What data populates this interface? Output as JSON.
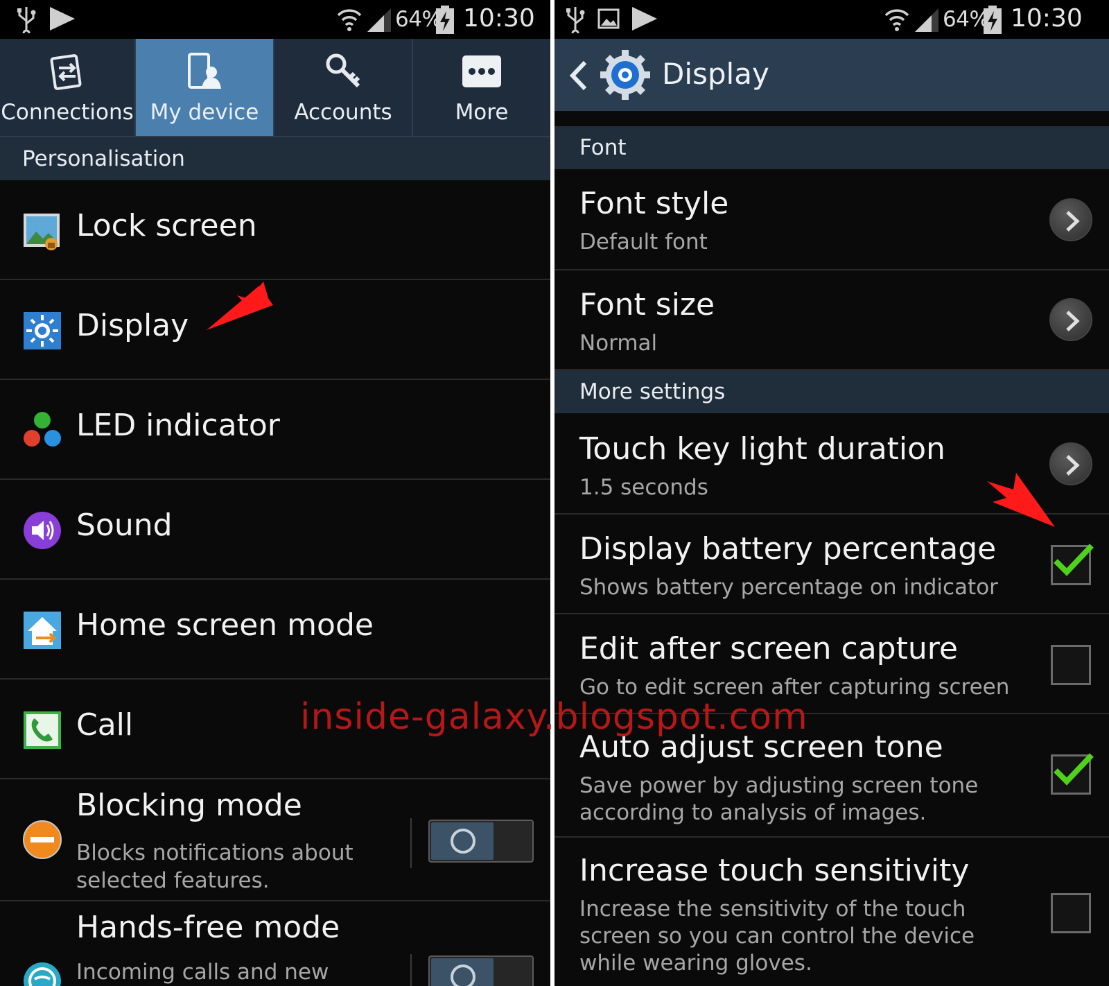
{
  "left": {
    "status": {
      "battery": "64%",
      "time": "10:30"
    },
    "tabs": [
      {
        "label": "Connections",
        "icon": "connections-icon"
      },
      {
        "label": "My device",
        "icon": "my-device-icon",
        "active": true
      },
      {
        "label": "Accounts",
        "icon": "accounts-icon"
      },
      {
        "label": "More",
        "icon": "more-icon"
      }
    ],
    "section": "Personalisation",
    "items": [
      {
        "title": "Lock screen",
        "icon": "lock-screen-icon"
      },
      {
        "title": "Display",
        "icon": "display-icon"
      },
      {
        "title": "LED indicator",
        "icon": "led-indicator-icon"
      },
      {
        "title": "Sound",
        "icon": "sound-icon"
      },
      {
        "title": "Home screen mode",
        "icon": "home-screen-icon"
      },
      {
        "title": "Call",
        "icon": "call-icon"
      },
      {
        "title": "Blocking mode",
        "sub": "Blocks notifications about selected features.",
        "icon": "blocking-mode-icon",
        "toggle": false
      },
      {
        "title": "Hands-free mode",
        "sub": "Incoming calls and new",
        "icon": "hands-free-icon",
        "toggle": false
      }
    ]
  },
  "right": {
    "status": {
      "battery": "64%",
      "time": "10:30"
    },
    "title": "Display",
    "sections": {
      "font": "Font",
      "more": "More settings"
    },
    "items": [
      {
        "title": "Font style",
        "sub": "Default font"
      },
      {
        "title": "Font size",
        "sub": "Normal"
      },
      {
        "title": "Touch key light duration",
        "sub": "1.5 seconds"
      },
      {
        "title": "Display battery percentage",
        "sub": "Shows battery percentage on indicator",
        "checked": true
      },
      {
        "title": "Edit after screen capture",
        "sub": "Go to edit screen after capturing screen",
        "checked": false
      },
      {
        "title": "Auto adjust screen tone",
        "sub": "Save power by adjusting screen tone according to analysis of images.",
        "checked": true
      },
      {
        "title": "Increase touch sensitivity",
        "sub": "Increase the sensitivity of the touch screen so you can control the device while wearing gloves.",
        "checked": false
      }
    ]
  },
  "watermark": "inside-galaxy.blogspot.com",
  "colors": {
    "active_tab": "#4a7fae",
    "header_bg": "#202d3a",
    "check": "#4fd21c",
    "annotation": "#ff1a1a"
  }
}
